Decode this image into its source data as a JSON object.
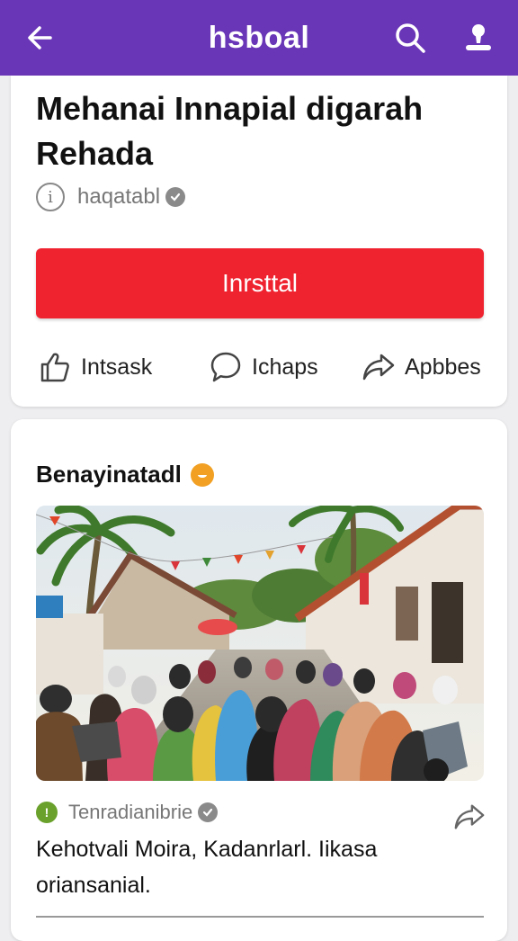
{
  "appbar": {
    "title": "hsboal",
    "background": "#6a36b8"
  },
  "post": {
    "headline": "Mehanai Innapial digarah Rehada",
    "source": "haqatabl",
    "install_label": "Inrsttal",
    "install_color": "#ef2330",
    "actions": [
      {
        "icon": "thumbs-up-icon",
        "label": "Intsask"
      },
      {
        "icon": "comment-icon",
        "label": "Ichaps"
      },
      {
        "icon": "share-icon",
        "label": "Apbbes"
      }
    ]
  },
  "feed_item": {
    "title": "Benayinatadl",
    "source": "Tenradianibrie",
    "caption": "Kehotvali Moira, Kadanrlarl. Iikasa oriansanial.",
    "image_icon": "village-crowd-photo"
  }
}
